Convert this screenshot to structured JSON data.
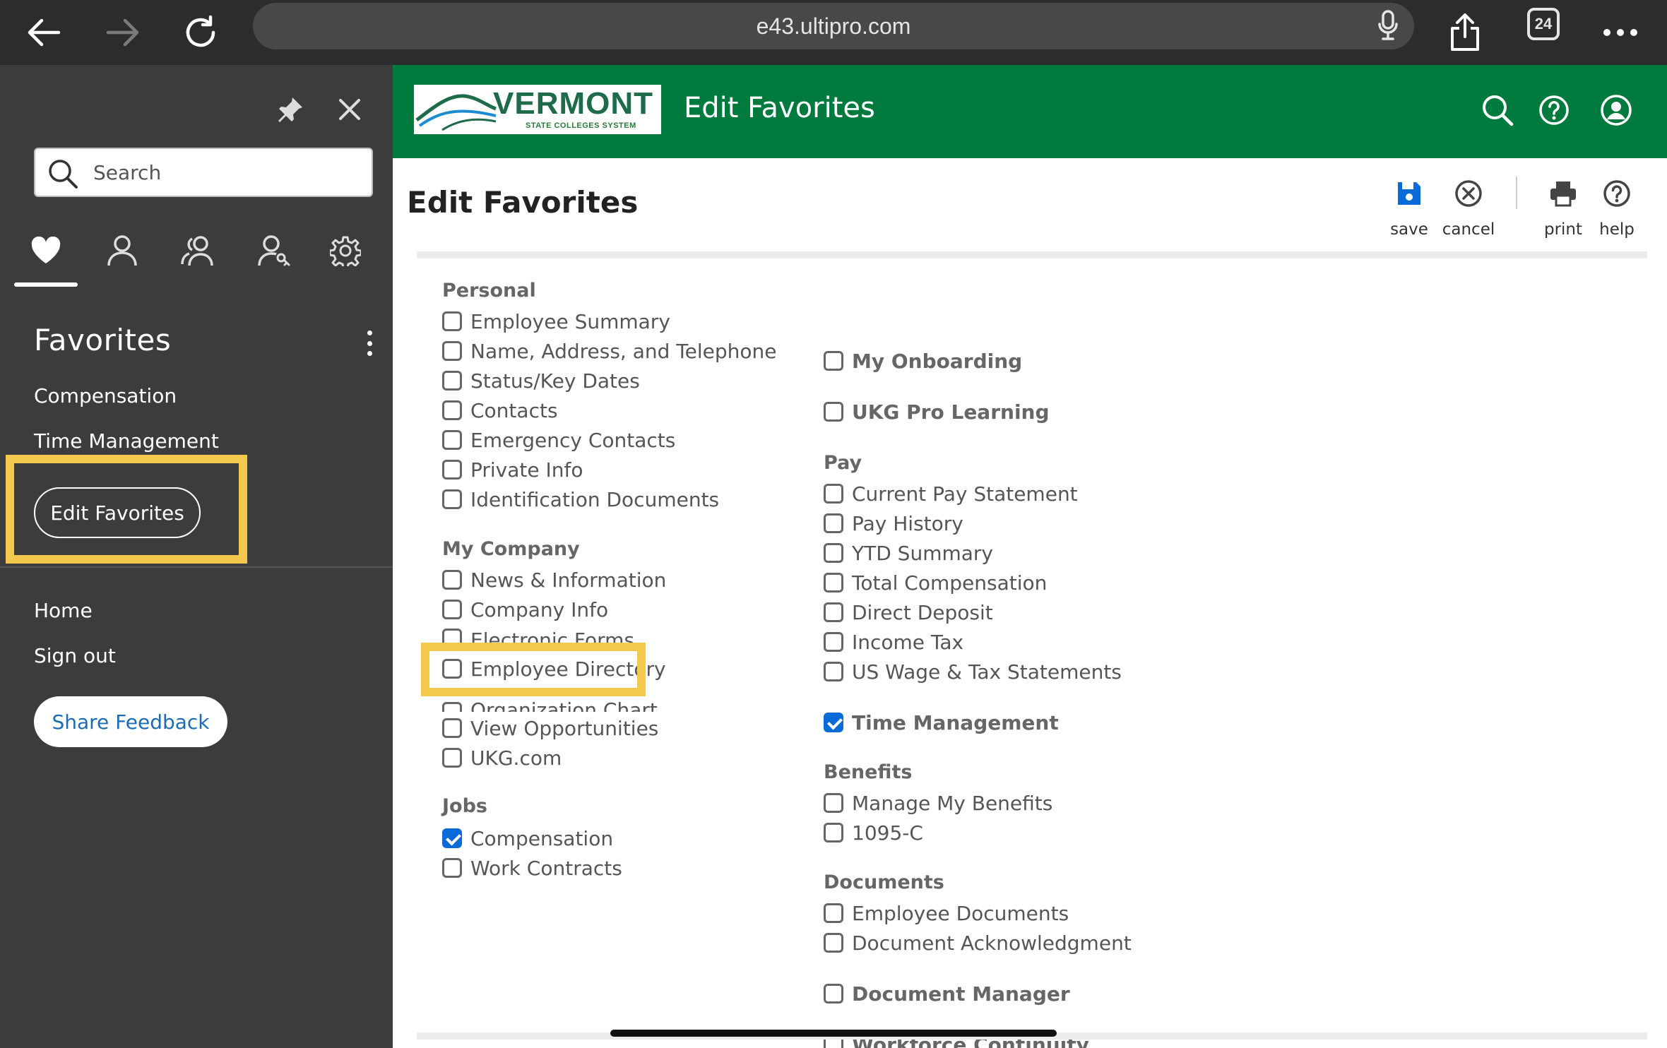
{
  "browser": {
    "url": "e43.ultipro.com",
    "tab_count": "24"
  },
  "sidebar": {
    "search_placeholder": "Search",
    "favorites_title": "Favorites",
    "favorites": [
      "Compensation",
      "Time Management"
    ],
    "edit_favorites_label": "Edit Favorites",
    "links": [
      "Home",
      "Sign out"
    ],
    "share_feedback_label": "Share Feedback",
    "tabs": [
      "heart-icon",
      "person-icon",
      "people-icon",
      "person-key-icon",
      "gear-icon"
    ]
  },
  "header": {
    "logo_text": "VERMONT",
    "logo_subtext": "STATE COLLEGES SYSTEM",
    "title": "Edit Favorites"
  },
  "page": {
    "title": "Edit Favorites",
    "toolbar": {
      "save": "save",
      "cancel": "cancel",
      "print": "print",
      "help": "help"
    }
  },
  "sections": {
    "personal": {
      "heading": "Personal",
      "items": [
        "Employee Summary",
        "Name, Address, and Telephone",
        "Status/Key Dates",
        "Contacts",
        "Emergency Contacts",
        "Private Info",
        "Identification Documents"
      ]
    },
    "my_company": {
      "heading": "My Company",
      "items": [
        "News & Information",
        "Company Info",
        "Electronic Forms",
        "Employee Directory",
        "Organization Chart",
        "View Opportunities",
        "UKG.com"
      ]
    },
    "jobs": {
      "heading": "Jobs",
      "items": [
        "Compensation",
        "Work Contracts"
      ],
      "checked": [
        true,
        false
      ]
    },
    "standalone_top": [
      "My Onboarding",
      "UKG Pro Learning"
    ],
    "pay": {
      "heading": "Pay",
      "items": [
        "Current Pay Statement",
        "Pay History",
        "YTD Summary",
        "Total Compensation",
        "Direct Deposit",
        "Income Tax",
        "US Wage & Tax Statements"
      ]
    },
    "time_management": "Time Management",
    "benefits": {
      "heading": "Benefits",
      "items": [
        "Manage My Benefits",
        "1095-C"
      ]
    },
    "documents": {
      "heading": "Documents",
      "items": [
        "Employee Documents",
        "Document Acknowledgment"
      ]
    },
    "standalone_bottom": [
      "Document Manager",
      "Workforce Continuity"
    ]
  },
  "colors": {
    "header_green": "#007a3d",
    "sidebar_bg": "#3c3c3c",
    "highlight": "#f2c94c",
    "check_blue": "#0a6bd8"
  }
}
